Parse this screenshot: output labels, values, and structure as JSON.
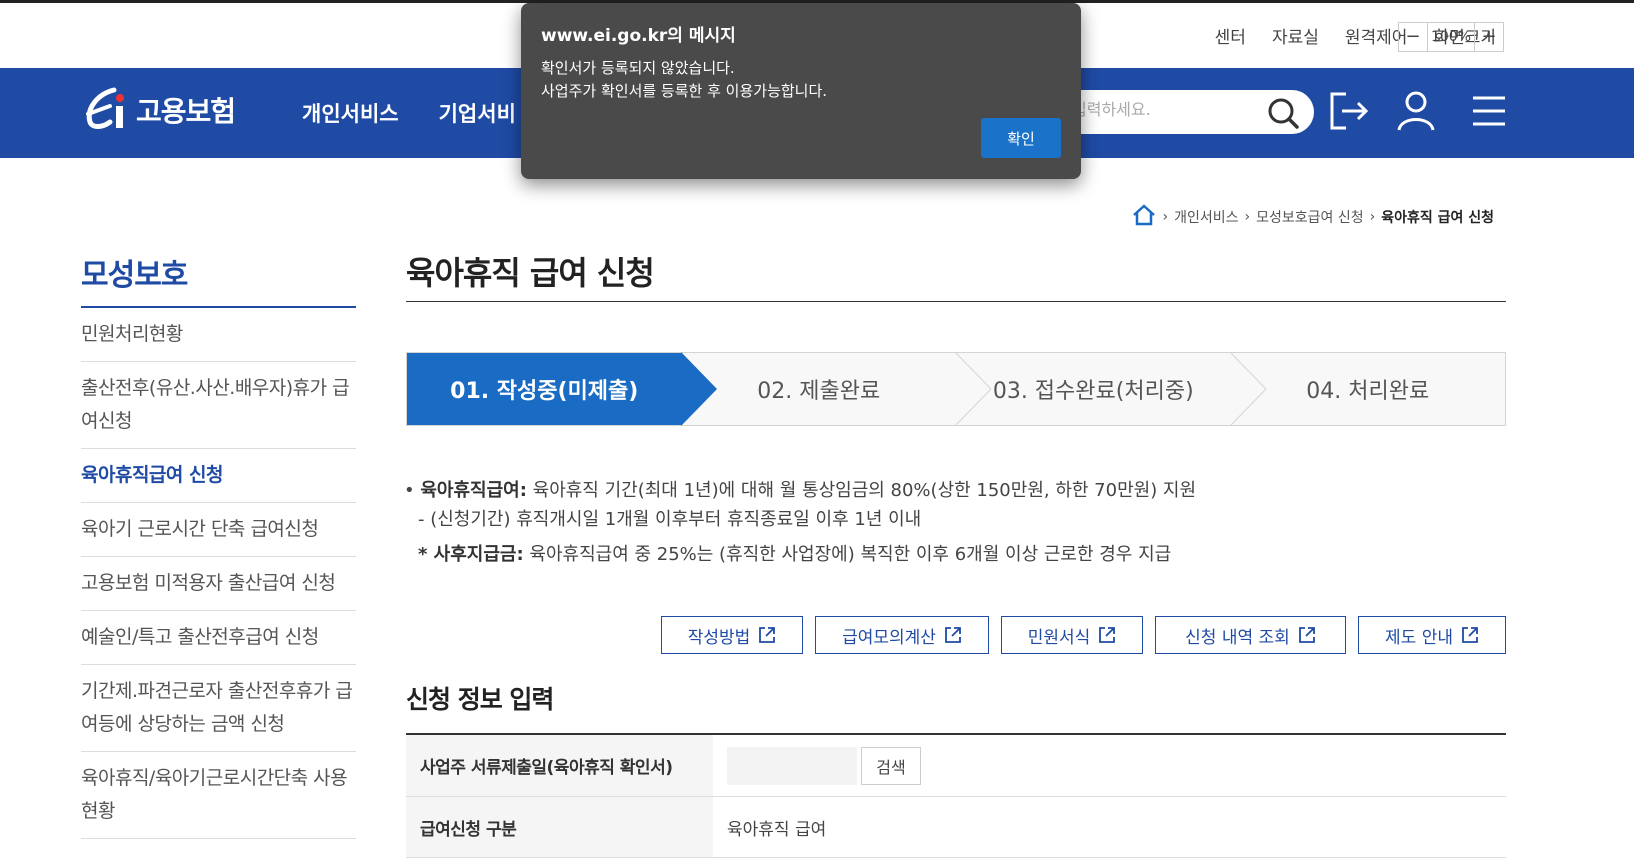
{
  "util": {
    "links": [
      "센터",
      "자료실",
      "원격제어",
      "화면크기"
    ],
    "zoom_minus": "−",
    "zoom_value": "100%",
    "zoom_plus": "+"
  },
  "header": {
    "logo_text": "고용보험",
    "menu": [
      "개인서비스",
      "기업서비"
    ],
    "search_placeholder": "입력하세요."
  },
  "dialog": {
    "title": "www.ei.go.kr의 메시지",
    "line1": "확인서가 등록되지 않았습니다.",
    "line2": "사업주가 확인서를 등록한 후 이용가능합니다.",
    "ok_label": "확인"
  },
  "breadcrumb": {
    "items": [
      "개인서비스",
      "모성보호급여 신청",
      "육아휴직 급여 신청"
    ]
  },
  "lnb": {
    "title": "모성보호",
    "items": [
      "민원처리현황",
      "출산전후(유산.사산.배우자)휴가 급여신청",
      "육아휴직급여 신청",
      "육아기 근로시간 단축 급여신청",
      "고용보험 미적용자 출산급여 신청",
      "예술인/특고 출산전후급여 신청",
      "기간제.파견근로자 출산전후휴가 급여등에 상당하는 금액 신청",
      "육아휴직/육아기근로시간단축 사용 현황"
    ]
  },
  "main": {
    "title": "육아휴직 급여 신청",
    "steps": [
      "01. 작성중(미제출)",
      "02. 제출완료",
      "03. 접수완료(처리중)",
      "04. 처리완료"
    ],
    "info": {
      "bullet1_label": "육아휴직급여:",
      "bullet1_text": " 육아휴직 기간(최대 1년)에 대해 월 통상임금의 80%(상한 150만원, 하한 70만원) 지원",
      "bullet2": "- (신청기간) 휴직개시일 1개월 이후부터 휴직종료일 이후 1년 이내",
      "bullet3_label": "* 사후지급금:",
      "bullet3_text": " 육아휴직급여 중 25%는 (휴직한 사업장에) 복직한 이후 6개월 이상 근로한 경우 지급"
    },
    "buttons": [
      "작성방법",
      "급여모의계산",
      "민원서식",
      "신청 내역 조회",
      "제도 안내"
    ],
    "section_title": "신청 정보 입력",
    "form": {
      "row1_label": "사업주 서류제출일(육아휴직 확인서)",
      "row1_button": "검색",
      "row2_label": "급여신청 구분",
      "row2_value": "육아휴직 급여"
    }
  },
  "colors": {
    "brand_blue": "#1f4ba5",
    "step_active": "#1a6bc4",
    "dialog_bg": "#4a4a4a",
    "dialog_button": "#1a73c9"
  }
}
